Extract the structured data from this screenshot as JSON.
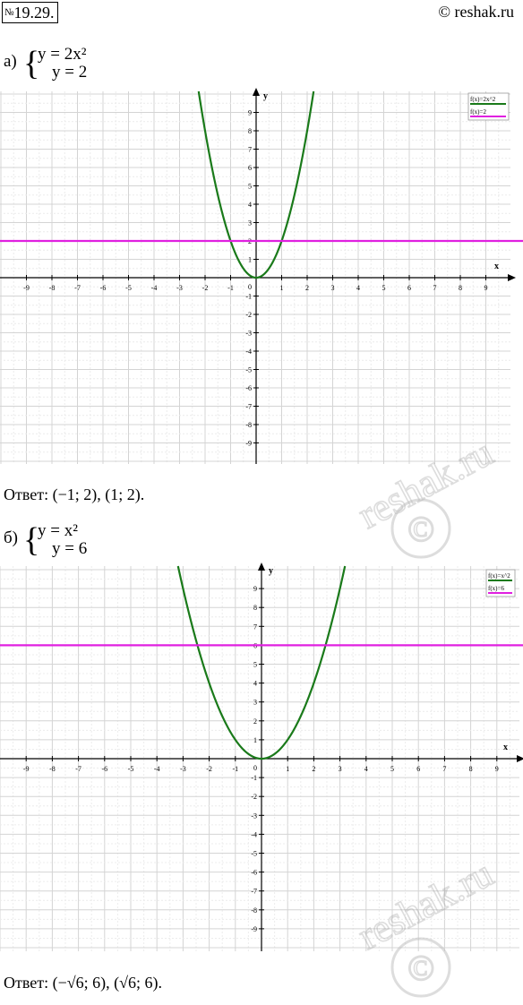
{
  "header": {
    "number_prefix": "№",
    "number": "19.29.",
    "copyright": "© reshak.ru"
  },
  "watermark": {
    "text": "reshak.ru",
    "symbol": "©"
  },
  "parts": [
    {
      "label": "а)",
      "eq1": "y = 2x²",
      "eq2": "y = 2",
      "answer": "Ответ: (−1; 2), (1; 2)."
    },
    {
      "label": "б)",
      "eq1": "y = x²",
      "eq2": "y = 6",
      "answer": "Ответ: (−√6; 6), (√6; 6)."
    }
  ],
  "chart_data": [
    {
      "type": "line",
      "xlabel": "x",
      "ylabel": "y",
      "xlim": [
        -10,
        10
      ],
      "ylim": [
        -10,
        10
      ],
      "grid": true,
      "legend_placement": "top-right",
      "x_ticks": [
        -9,
        -8,
        -7,
        -6,
        -5,
        -4,
        -3,
        -2,
        -1,
        1,
        2,
        3,
        4,
        5,
        6,
        7,
        8,
        9
      ],
      "y_ticks": [
        9,
        8,
        7,
        6,
        5,
        4,
        3,
        2,
        1,
        -1,
        -2,
        -3,
        -4,
        -5,
        -6,
        -7,
        -8,
        -9
      ],
      "origin_label": "0",
      "series": [
        {
          "name": "f(x)=2x^2",
          "color": "#1a7a1a",
          "kind": "parabola",
          "a": 2
        },
        {
          "name": "f(x)=2",
          "color": "#e020e0",
          "kind": "constant",
          "c": 2
        }
      ]
    },
    {
      "type": "line",
      "xlabel": "x",
      "ylabel": "y",
      "xlim": [
        -10,
        10
      ],
      "ylim": [
        -10,
        10
      ],
      "grid": true,
      "legend_placement": "top-right",
      "x_ticks": [
        -9,
        -8,
        -7,
        -6,
        -5,
        -4,
        -3,
        -2,
        -1,
        1,
        2,
        3,
        4,
        5,
        6,
        7,
        8,
        9
      ],
      "y_ticks": [
        9,
        8,
        7,
        6,
        5,
        4,
        3,
        2,
        1,
        -1,
        -2,
        -3,
        -4,
        -5,
        -6,
        -7,
        -8,
        -9
      ],
      "origin_label": "0",
      "series": [
        {
          "name": "f(x)=x^2",
          "color": "#1a7a1a",
          "kind": "parabola",
          "a": 1
        },
        {
          "name": "f(x)=6",
          "color": "#e020e0",
          "kind": "constant",
          "c": 6
        }
      ]
    }
  ]
}
